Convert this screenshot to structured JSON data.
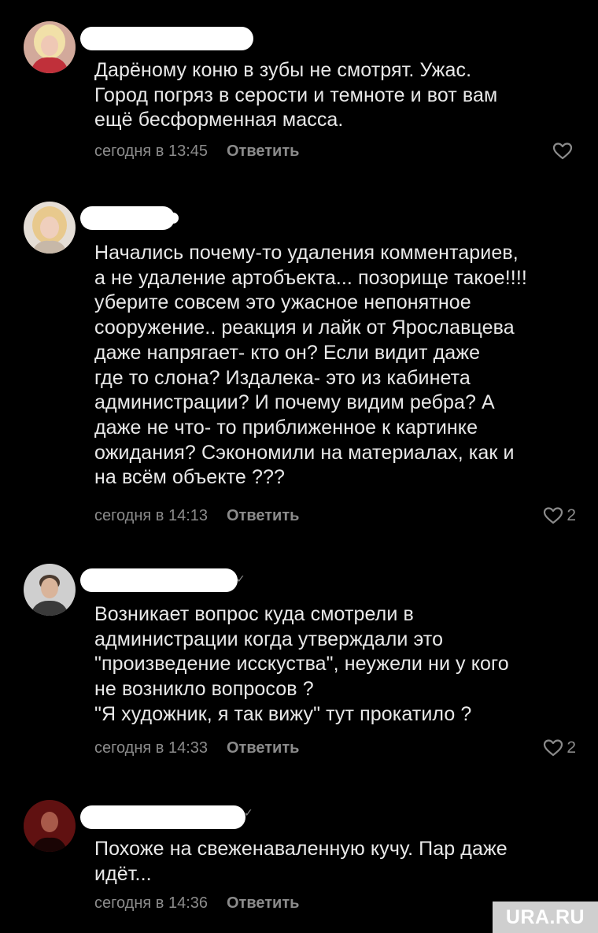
{
  "comments": [
    {
      "text": "Дарёному коню в зубы не смотрят. Ужас.\nГород погряз в серости и темноте и вот вам\nещё бесформенная масса.",
      "time": "сегодня в 13:45",
      "reply": "Ответить",
      "likes": ""
    },
    {
      "text": "Начались почему-то удаления комментариев,\nа не удаление артобъекта... позорище такое!!!!\nуберите совсем это ужасное непонятное\nсооружение..  реакция и лайк от Ярославцева\nдаже напрягает- кто он? Если видит даже\nгде то слона? Издалека- это из кабинета\nадминистрации?  И почему видим ребра? А\nдаже  не что-  то приближенное  к картинке\nожидания?  Сэкономили на материалах, как и\nна всём объекте ???",
      "time": "сегодня в 14:13",
      "reply": "Ответить",
      "likes": "2"
    },
    {
      "text": "Возникает вопрос куда смотрели в\nадминистрации когда утверждали это\n\"произведение исскуства\", неужели ни у кого\nне возникло вопросов ?\n\"Я художник, я так вижу\" тут прокатило ?",
      "time": "сегодня в 14:33",
      "reply": "Ответить",
      "likes": "2"
    },
    {
      "text": "Похоже на свеженаваленную кучу. Пар даже\nидёт...",
      "time": "сегодня в 14:36",
      "reply": "Ответить",
      "likes": ""
    }
  ],
  "watermark": "URA.RU",
  "colors": {
    "background": "#000000",
    "text": "#e9e9e9",
    "meta": "#8b8b8b",
    "name_redaction": "#ffffff"
  }
}
